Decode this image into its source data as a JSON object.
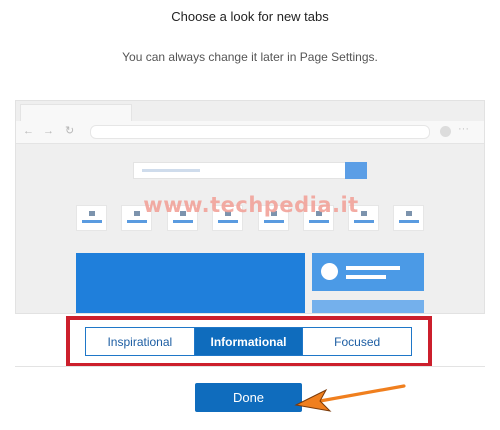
{
  "dialog": {
    "title": "Choose a look for new tabs",
    "subtitle": "You can always change it later in Page Settings."
  },
  "preview": {
    "nav_icons": [
      "back-arrow-icon",
      "forward-arrow-icon",
      "refresh-icon"
    ],
    "nav_glyphs": {
      "back": "←",
      "forward": "→",
      "refresh": "↻"
    },
    "menu_glyph": "···",
    "watermark": "www.techpedia.it",
    "tile_count": 8
  },
  "layout_options": [
    {
      "label": "Inspirational",
      "selected": false
    },
    {
      "label": "Informational",
      "selected": true
    },
    {
      "label": "Focused",
      "selected": false
    }
  ],
  "done_label": "Done",
  "colors": {
    "accent": "#0f6cbd",
    "highlight_box": "#cc1f2c",
    "annotation_arrow": "#f07f1e",
    "hero_blue": "#1f7fdb"
  }
}
